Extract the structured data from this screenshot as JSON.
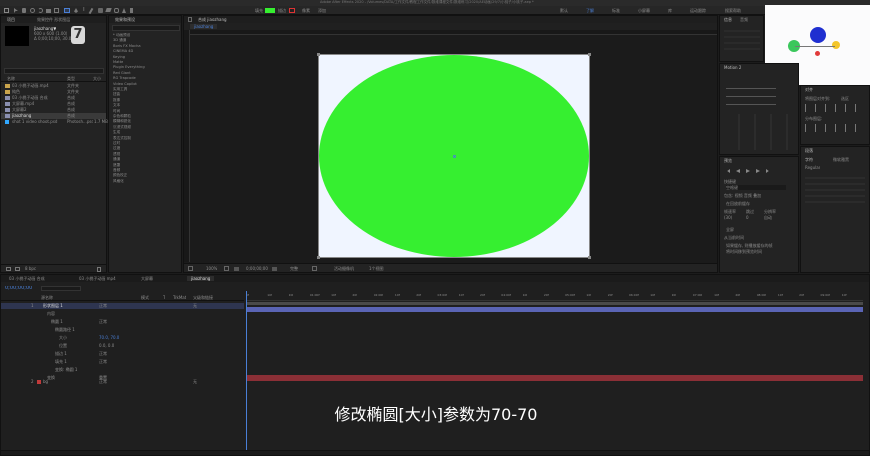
{
  "app": {
    "title": "Adobe After Effects 2020 - /Volumes/DATA/工作文件/教程工作文件/数维课程文件/数维练习/2020/AE动画/29/7/小桃子/小桃子.aep *"
  },
  "toolbar": {
    "fill_label": "填充",
    "stroke_label": "描边",
    "px_label": "像素",
    "add_label": "添加",
    "workspaces": [
      "默认",
      "了解",
      "标准",
      "小屏幕",
      "库",
      "运动跟踪",
      "对齐"
    ],
    "search_label": "搜索帮助"
  },
  "project": {
    "tab_label": "项目",
    "effects_tab": "效果控件 形状图层",
    "comp_name": "jiaozhang▼",
    "comp_info": [
      "600 x 600 (1.00)",
      "Δ 0;00;10;00, 30.00 fps"
    ],
    "badge": "7",
    "columns": [
      "名称",
      "类型",
      "大小"
    ],
    "items": [
      {
        "name": "03 小桃子动画.mp4",
        "type": "文件夹",
        "size": ""
      },
      {
        "name": "纯色",
        "type": "文件夹",
        "size": ""
      },
      {
        "name": "03 小桃子动画 合成",
        "type": "合成",
        "size": ""
      },
      {
        "name": "大屏幕.mp4",
        "type": "合成",
        "size": ""
      },
      {
        "name": "大屏幕2",
        "type": "合成",
        "size": ""
      },
      {
        "name": "jiaozhang",
        "type": "合成",
        "size": ""
      },
      {
        "name": "shot 1 video shoot.psd",
        "type": "Photosh...psd",
        "size": "1.7 MB"
      }
    ],
    "bpc": "8 bpc"
  },
  "effects_panel": {
    "tab_label": "效果和预设",
    "items": [
      "* 动画预设",
      "3D 通道",
      "Boris FX Mocha",
      "CINEMA 4D",
      "Keying",
      "Matte",
      "Plugin Everything",
      "Red Giant",
      "RG Trapcode",
      "Video Copilot",
      "实用工具",
      "扭曲",
      "抠像",
      "文本",
      "时间",
      "杂色和颗粒",
      "模糊和锐化",
      "沉浸式视频",
      "生成",
      "表达式控制",
      "过时",
      "过渡",
      "透视",
      "通道",
      "遮罩",
      "音频",
      "颜色校正",
      "风格化"
    ]
  },
  "composition": {
    "tab_label": "合成 jiaozhang",
    "sub_tab": "jiaozhang",
    "ellipse_color": "#36ef30",
    "bg_color": "#f0f5ff",
    "zoom": "100%",
    "timecode": "0;00;00;00",
    "resolution": "完整",
    "camera": "活动摄像机",
    "views": "1个视图"
  },
  "timeline": {
    "tabs": [
      "03 小桃子动画 合成",
      "03 小桃子动画 mp4",
      "大屏幕",
      "jiaozhang"
    ],
    "timecode": "0;00;00;00",
    "columns": [
      "源名称",
      "模式",
      "T",
      "TrkMat",
      "父级和链接"
    ],
    "layers": [
      {
        "num": "1",
        "name": "形状图层 1",
        "mode": "正常",
        "parent": "无"
      },
      {
        "num": "",
        "name": "内容",
        "mode": "",
        "parent": ""
      },
      {
        "num": "",
        "name": "椭圆 1",
        "mode": "正常",
        "parent": ""
      },
      {
        "num": "",
        "name": "椭圆路径 1",
        "mode": "",
        "parent": ""
      },
      {
        "num": "",
        "name": "大小",
        "mode": "70.0, 70.0",
        "parent": ""
      },
      {
        "num": "",
        "name": "位置",
        "mode": "0.0, 0.0",
        "parent": ""
      },
      {
        "num": "",
        "name": "描边 1",
        "mode": "正常",
        "parent": ""
      },
      {
        "num": "",
        "name": "填充 1",
        "mode": "正常",
        "parent": ""
      },
      {
        "num": "",
        "name": "变换: 椭圆 1",
        "mode": "",
        "parent": ""
      },
      {
        "num": "",
        "name": "变换",
        "mode": "重置",
        "parent": ""
      },
      {
        "num": "2",
        "name": "bg",
        "mode": "正常",
        "parent": "无"
      }
    ],
    "ruler": [
      "0f",
      "10f",
      "20f",
      "01:00f",
      "10f",
      "20f",
      "02:00f",
      "10f",
      "20f",
      "03:00f",
      "10f",
      "20f",
      "04:00f",
      "10f",
      "20f",
      "05:00f",
      "10f",
      "20f",
      "06:00f",
      "10f",
      "20f",
      "07:00f",
      "10f",
      "20f",
      "08:00f",
      "10f",
      "20f",
      "09:00f",
      "10f"
    ],
    "layer_bar_color": "#5a64b4",
    "bg_bar_color": "#8b2f36"
  },
  "subtitle": "修改椭圆[大小]参数为70-70",
  "right_panels": {
    "info_tab": "信息",
    "audio_tab": "音频",
    "motion_tab": "Motion 2",
    "align_tab": "对齐",
    "preview_tab": "预览",
    "preview_shortcut": "快捷键",
    "preview_key": "空格键",
    "preview_options": [
      "包含: 视频 音频 叠加",
      "在回放前缓存",
      "帧速率",
      "跳过",
      "分辨率",
      "(30)",
      "0",
      "自动"
    ],
    "paragraph_tab": "段落",
    "char_tab": "字符",
    "char_font": "微软雅黑",
    "char_style": "Regular",
    "align_items": [
      "将图层对齐到:",
      "选区",
      "分布图层:"
    ],
    "preview_bottom": [
      "全屏",
      "从当前时间",
      "如果缓存, 则播放缓存的帧",
      "将时间移到预览时间"
    ]
  },
  "mini_preview": {
    "dots": [
      {
        "color": "#1f2fd0"
      },
      {
        "color": "#3bc75c"
      },
      {
        "color": "#f3c62b"
      },
      {
        "color": "#e13a3a"
      }
    ]
  }
}
